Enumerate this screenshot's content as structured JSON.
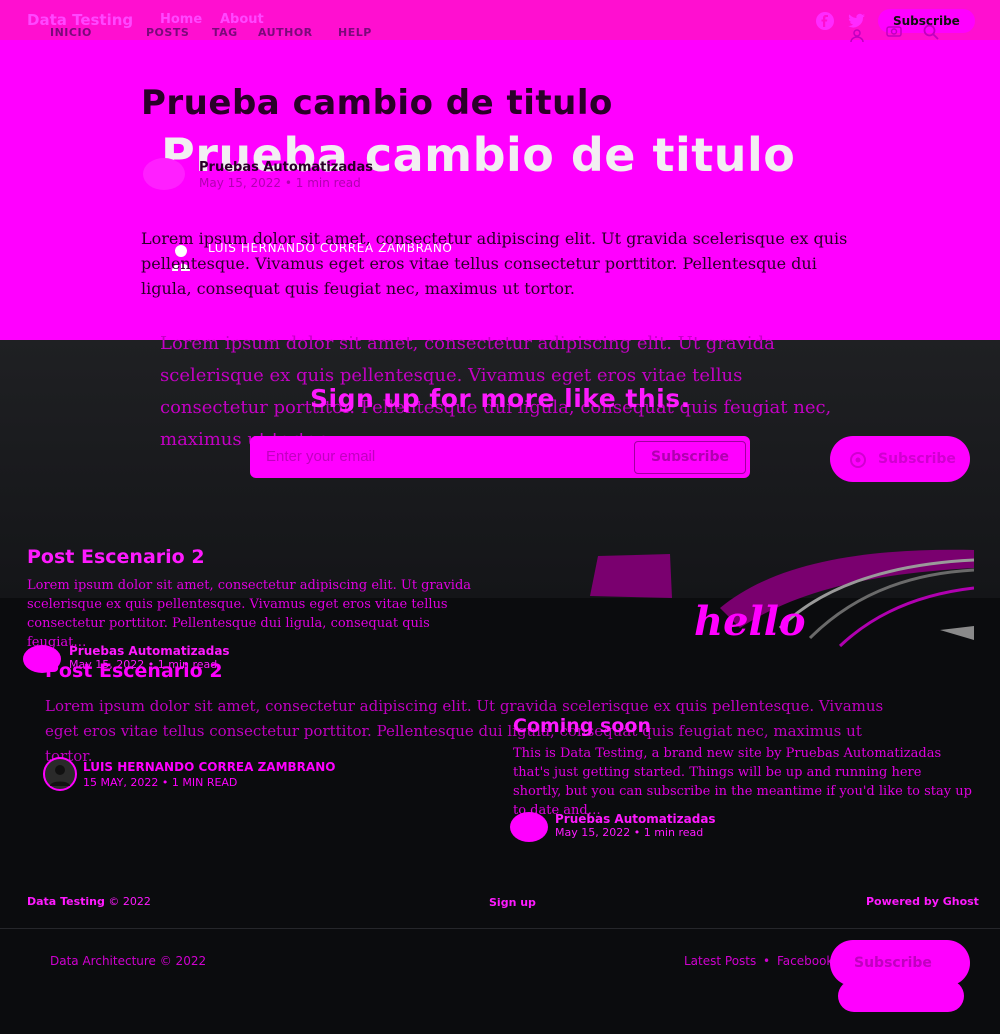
{
  "site": {
    "brand": "Data Testing",
    "nav": [
      "Home",
      "About"
    ],
    "subscribe_label": "Subscribe",
    "old_nav": [
      "INICIO",
      "POSTS",
      "TAG",
      "AUTHOR",
      "HELP"
    ]
  },
  "post": {
    "title": "Prueba cambio de titulo",
    "author": "Pruebas Automatizadas",
    "date": "May 15, 2022",
    "read_time": "1 min read",
    "author_old": "LUIS HERNANDO CORREA ZAMBRANO",
    "excerpt": "Lorem ipsum dolor sit amet, consectetur adipiscing elit. Ut gravida scelerisque ex quis pellentesque. Vivamus eget eros vitae tellus consectetur porttitor. Pellentesque dui ligula, consequat quis feugiat nec, maximus ut tortor."
  },
  "signup": {
    "heading": "Sign up for more like this.",
    "placeholder": "Enter your email",
    "button": "Subscribe",
    "float_button": "Subscribe"
  },
  "cards": [
    {
      "title": "Post Escenario 2",
      "excerpt": "Lorem ipsum dolor sit amet, consectetur adipiscing elit. Ut gravida scelerisque ex quis pellentesque. Vivamus eget eros vitae tellus consectetur porttitor. Pellentesque dui ligula, consequat quis feugiat…",
      "author": "Pruebas Automatizadas",
      "date": "May 15, 2022",
      "read_time": "1 min read"
    },
    {
      "title": "Coming soon",
      "excerpt": "This is Data Testing, a brand new site by Pruebas Automatizadas that's just getting started. Things will be up and running here shortly, but you can subscribe in the meantime if you'd like to stay up to date and…",
      "author": "Pruebas Automatizadas",
      "date": "May 15, 2022",
      "read_time": "1 min read",
      "image_text": "hello"
    }
  ],
  "old_card": {
    "title": "Post Escenario 2",
    "excerpt": "Lorem ipsum dolor sit amet, consectetur adipiscing elit. Ut gravida scelerisque ex quis pellentesque. Vivamus eget eros vitae tellus consectetur porttitor. Pellentesque dui ligula, consequat quis feugiat nec, maximus ut tortor.",
    "author": "LUIS HERNANDO CORREA ZAMBRANO",
    "date": "15 MAY, 2022",
    "read_time": "1 MIN READ"
  },
  "footer": {
    "copyright_brand": "Data Testing",
    "copyright_year": "© 2022",
    "signup_link": "Sign up",
    "powered": "Powered by Ghost",
    "old_copyright": "Data Architecture © 2022",
    "old_links": [
      "Latest Posts",
      "Facebook"
    ],
    "old_float": "Subscribe"
  },
  "colors": {
    "accent": "#ff00ff",
    "dark": "#0b0c0e"
  },
  "icons": [
    "facebook-icon",
    "twitter-icon",
    "search-icon",
    "user-icon"
  ]
}
